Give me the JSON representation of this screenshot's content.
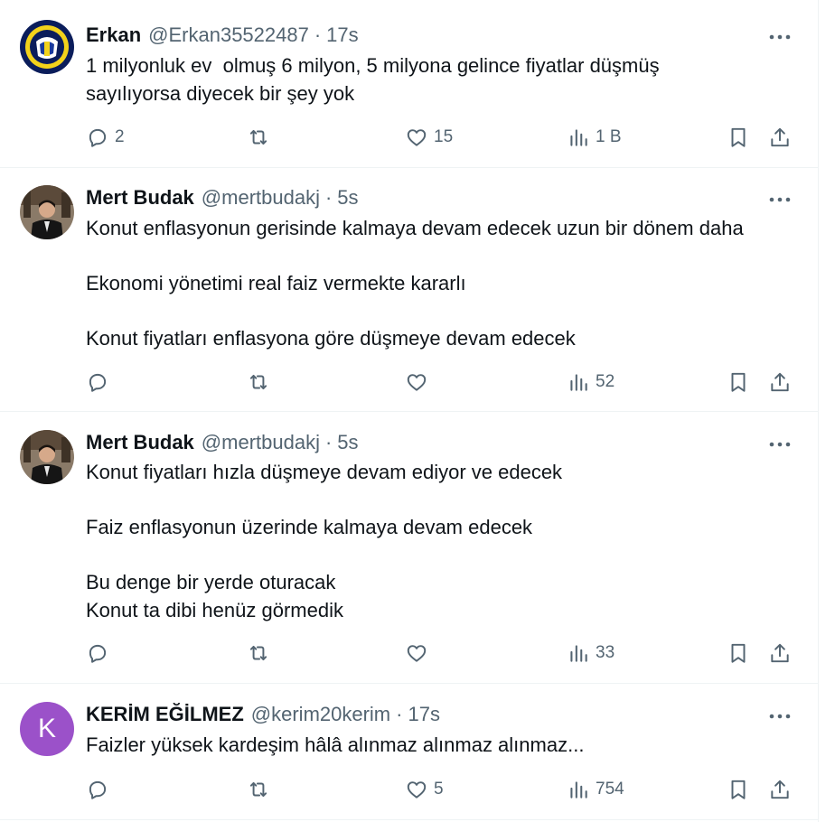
{
  "tweets": [
    {
      "name": "Erkan",
      "handle": "@Erkan35522487",
      "separator": "·",
      "time": "17s",
      "lines": [
        "1 milyonluk ev  olmuş 6 milyon, 5 milyona gelince fiyatlar düşmüş",
        "sayılıyorsa diyecek bir şey yok"
      ],
      "replies": "2",
      "retweets": "",
      "likes": "15",
      "views": "1 B",
      "avatar": "team-crest-avatar"
    },
    {
      "name": "Mert Budak",
      "handle": "@mertbudakj",
      "separator": "·",
      "time": "5s",
      "lines": [
        "Konut enflasyonun gerisinde kalmaya devam edecek uzun bir dönem daha",
        "",
        "Ekonomi yönetimi real faiz vermekte kararlı",
        "",
        "Konut fiyatları enflasyona göre düşmeye devam edecek"
      ],
      "replies": "",
      "retweets": "",
      "likes": "",
      "views": "52",
      "avatar": "person-photo-avatar"
    },
    {
      "name": "Mert Budak",
      "handle": "@mertbudakj",
      "separator": "·",
      "time": "5s",
      "lines": [
        "Konut fiyatları hızla düşmeye devam ediyor ve edecek",
        "",
        "Faiz enflasyonun üzerinde kalmaya devam edecek",
        "",
        "Bu denge bir yerde oturacak",
        "Konut ta dibi henüz görmedik"
      ],
      "replies": "",
      "retweets": "",
      "likes": "",
      "views": "33",
      "avatar": "person-photo-avatar"
    },
    {
      "name": "KERİM EĞİLMEZ",
      "handle": "@kerim20kerim",
      "separator": "·",
      "time": "17s",
      "lines": [
        "Faizler yüksek kardeşim hâlâ alınmaz alınmaz alınmaz..."
      ],
      "replies": "",
      "retweets": "",
      "likes": "5",
      "views": "754",
      "avatar": "letter-avatar",
      "avatar_letter": "K",
      "avatar_color": "#9b51c9"
    }
  ],
  "icons": {
    "reply": "reply-icon",
    "retweet": "retweet-icon",
    "like": "heart-icon",
    "views": "views-icon",
    "bookmark": "bookmark-icon",
    "share": "share-icon",
    "more": "more-icon"
  },
  "colors": {
    "text": "#0f1419",
    "secondary": "#536471",
    "divider": "#eff3f4"
  }
}
